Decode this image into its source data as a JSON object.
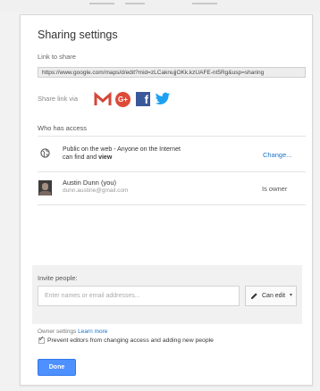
{
  "dialog": {
    "title": "Sharing settings",
    "link_label": "Link to share",
    "link_value": "https://www.google.com/maps/d/edit?mid=zLCaknujjOKk.kzUAFE-nt5Rg&usp=sharing",
    "share_via_label": "Share link via",
    "share_icons": [
      "gmail-icon",
      "google-plus-icon",
      "facebook-icon",
      "twitter-icon"
    ]
  },
  "access": {
    "label": "Who has access",
    "public": {
      "line1": "Public on the web - Anyone on the Internet",
      "line2_prefix": "can find and ",
      "line2_bold": "view",
      "change_label": "Change..."
    },
    "owner": {
      "name": "Austin Dunn (you)",
      "email": "dunn.austine@gmail.com",
      "role": "Is owner"
    }
  },
  "invite": {
    "label": "Invite people:",
    "placeholder": "Enter names or email addresses...",
    "permission": "Can edit",
    "permission_caret": "▾"
  },
  "owner_settings": {
    "label": "Owner settings",
    "learn_more": "Learn more",
    "checkbox_checked": true,
    "checkbox_label": "Prevent editors from changing access and adding new people"
  },
  "footer": {
    "done_label": "Done"
  },
  "colors": {
    "gmail": "#d44638",
    "google_plus": "#dd4b39",
    "facebook": "#3b5998",
    "twitter": "#1da1f2",
    "link": "#1a73c9",
    "done_button": "#4d90fe"
  }
}
